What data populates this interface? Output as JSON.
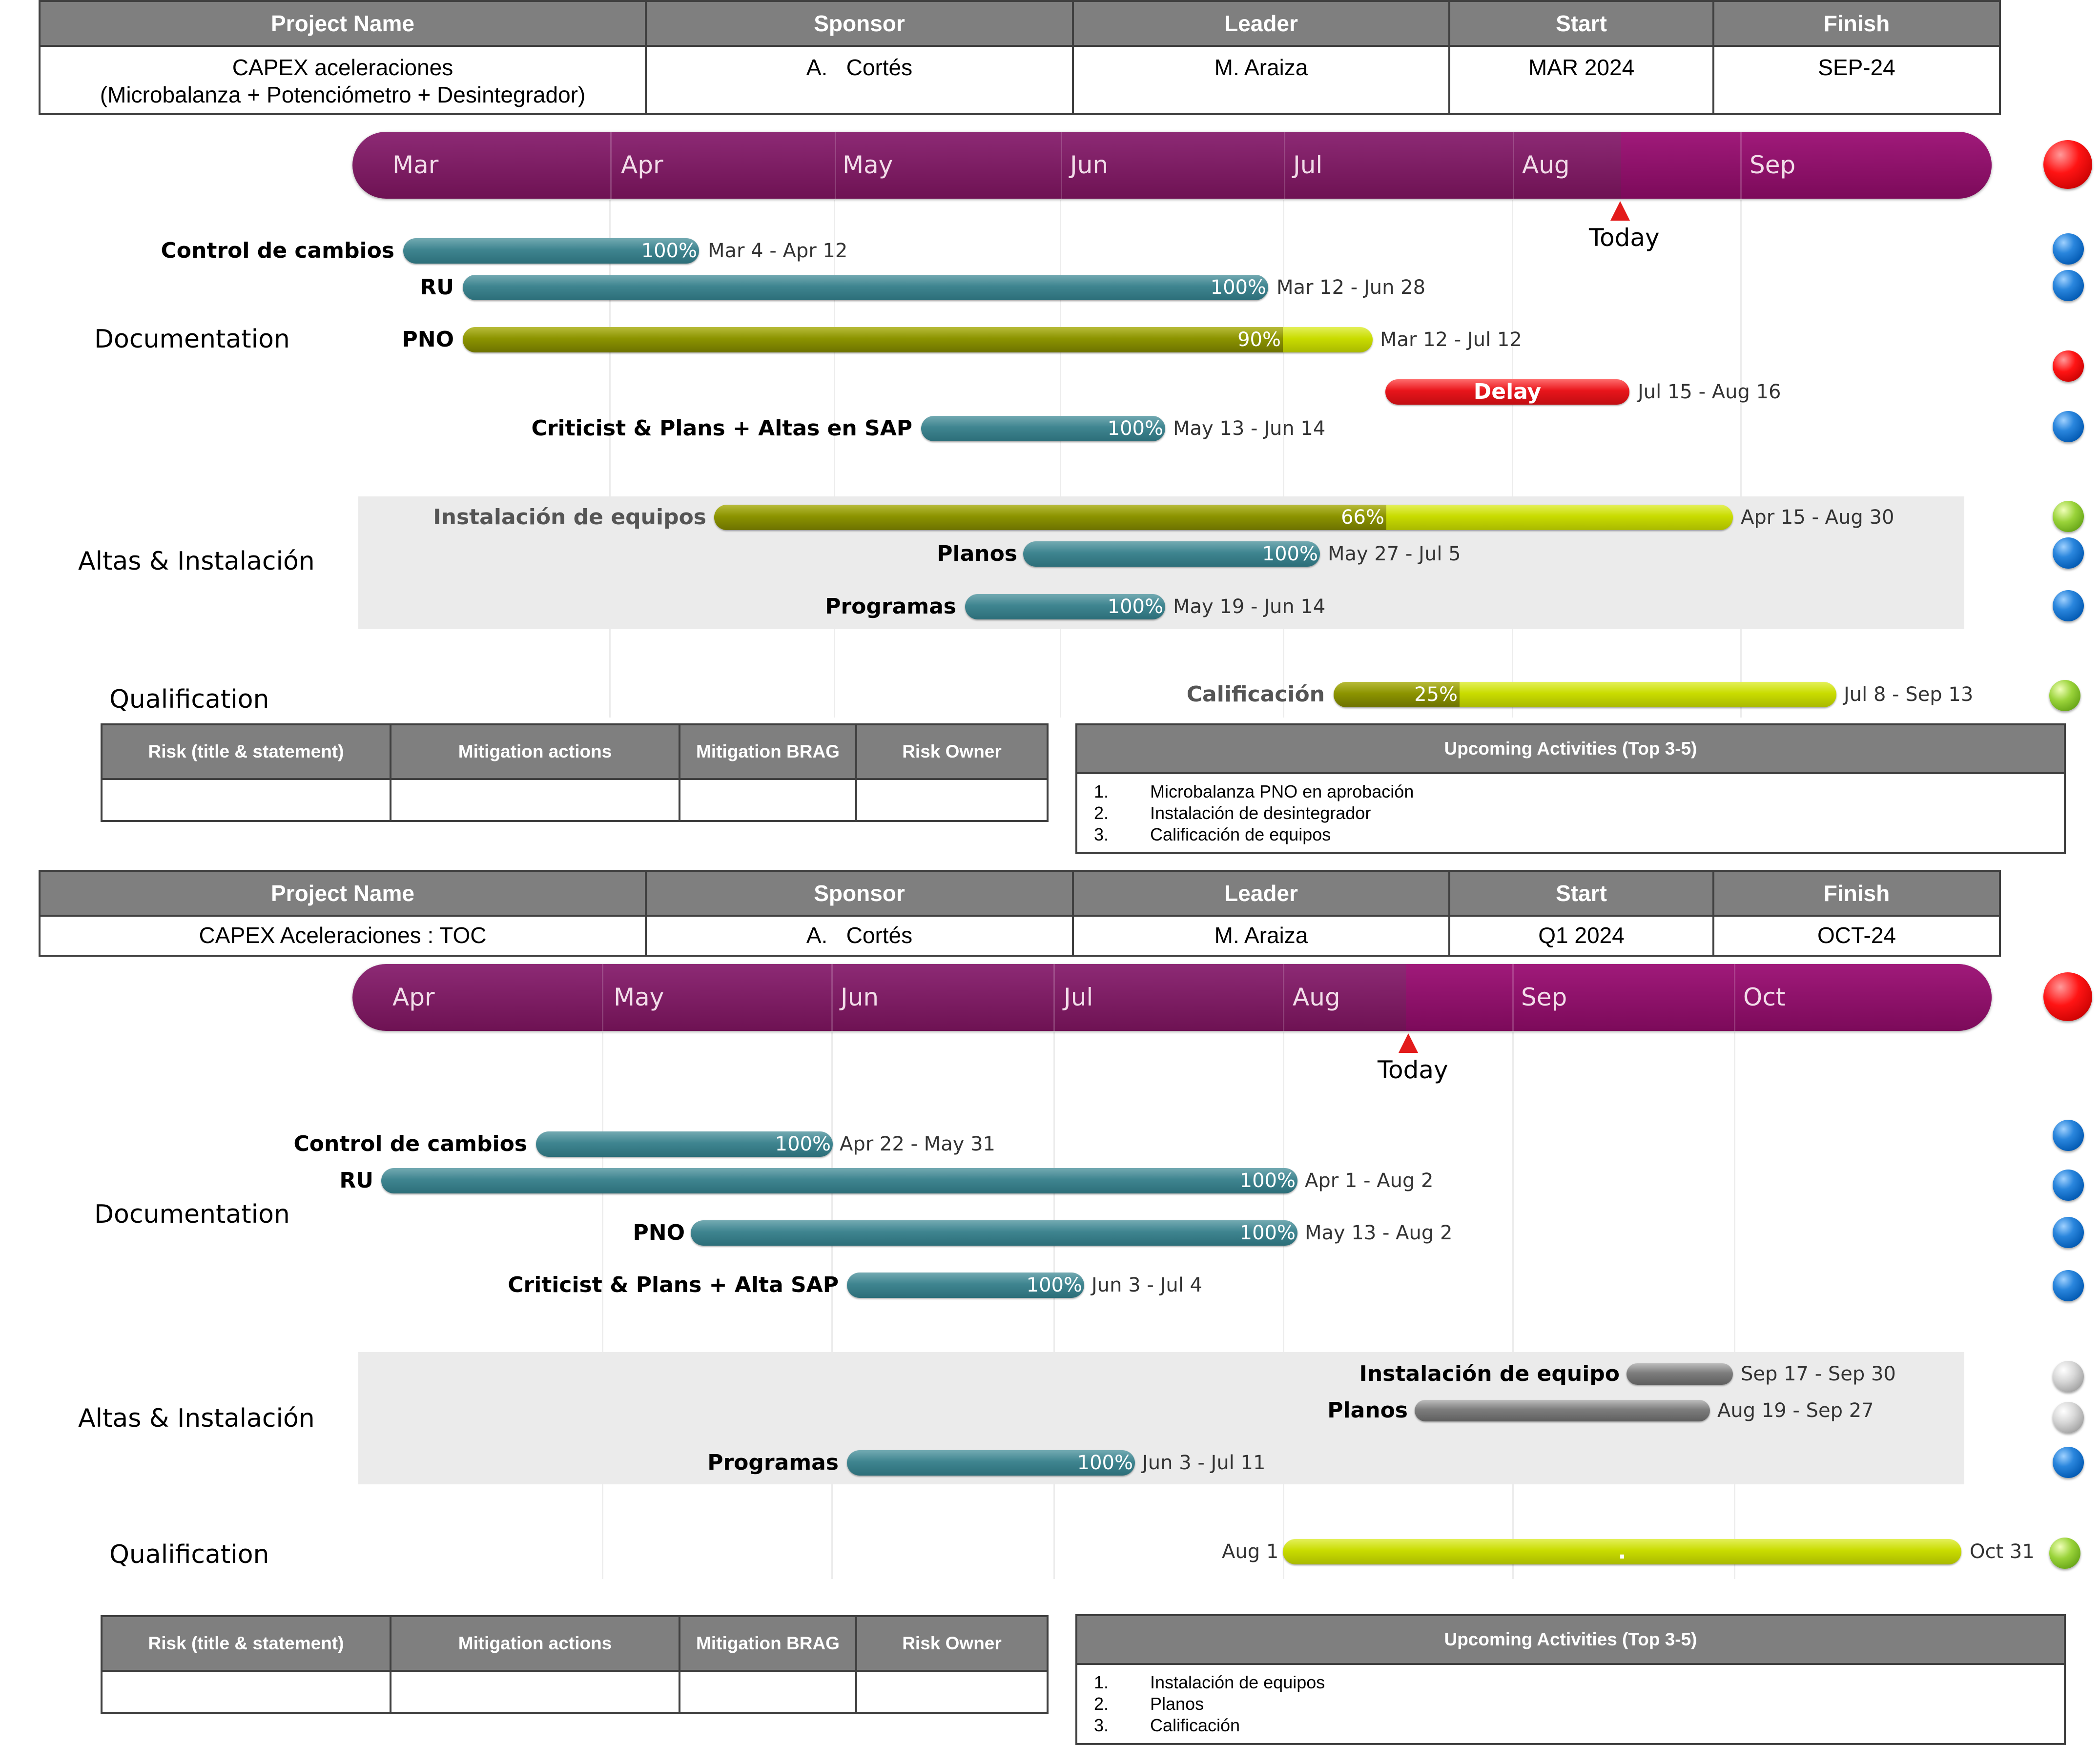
{
  "projects": [
    {
      "header": {
        "columns": [
          "Project Name",
          "Sponsor",
          "Leader",
          "Start",
          "Finish"
        ],
        "project_name_line1": "CAPEX aceleraciones",
        "project_name_line2": "(Microbalanza + Potenciómetro + Desintegrador)",
        "sponsor": "A.   Cortés",
        "leader": "M. Araiza",
        "start": "MAR 2024",
        "finish": "SEP-24"
      },
      "timeline": {
        "months": [
          "Mar",
          "Apr",
          "May",
          "Jun",
          "Jul",
          "Aug",
          "Sep"
        ],
        "today_label": "Today",
        "status_color": "red"
      },
      "groups": {
        "documentation": "Documentation",
        "altas": "Altas & Instalación",
        "qualification": "Qualification"
      },
      "tasks": [
        {
          "name": "Control de cambios",
          "percent": "100%",
          "dates": "Mar 4 - Apr 12",
          "status": "blue"
        },
        {
          "name": "RU",
          "percent": "100%",
          "dates": "Mar 12 - Jun 28",
          "status": "blue"
        },
        {
          "name": "PNO",
          "percent": "90%",
          "progress": 0.9,
          "dates": "Mar 12 - Jul 12",
          "status": ""
        },
        {
          "name": "",
          "bar_text": "Delay",
          "dates": "Jul 15 - Aug 16",
          "status": "red"
        },
        {
          "name": "Criticist & Plans + Altas en SAP",
          "percent": "100%",
          "dates": "May 13 - Jun 14",
          "status": "blue"
        },
        {
          "name": "Instalación de equipos",
          "percent": "66%",
          "progress": 0.66,
          "dates": "Apr 15 - Aug 30",
          "status": "green"
        },
        {
          "name": "Planos",
          "percent": "100%",
          "dates": "May 27 - Jul 5",
          "status": "blue"
        },
        {
          "name": "Programas",
          "percent": "100%",
          "dates": "May 19 - Jun 14",
          "status": "blue"
        },
        {
          "name": "Calificación",
          "percent": "25%",
          "progress": 0.25,
          "dates": "Jul 8 - Sep 13",
          "status": "green"
        }
      ],
      "risk_table": {
        "columns": [
          "Risk (title & statement)",
          "Mitigation actions",
          "Mitigation BRAG",
          "Risk Owner"
        ]
      },
      "upcoming": {
        "title": "Upcoming Activities (Top 3-5)",
        "items": [
          {
            "num": "1.",
            "text": "Microbalanza PNO en aprobación"
          },
          {
            "num": "2.",
            "text": "Instalación de desintegrador"
          },
          {
            "num": "3.",
            "text": "Calificación de equipos"
          }
        ]
      }
    },
    {
      "header": {
        "columns": [
          "Project Name",
          "Sponsor",
          "Leader",
          "Start",
          "Finish"
        ],
        "project_name_line1": "CAPEX Aceleraciones : TOC",
        "sponsor": "A.   Cortés",
        "leader": "M. Araiza",
        "start": "Q1 2024",
        "finish": "OCT-24"
      },
      "timeline": {
        "months": [
          "Apr",
          "May",
          "Jun",
          "Jul",
          "Aug",
          "Sep",
          "Oct"
        ],
        "today_label": "Today",
        "status_color": "red"
      },
      "groups": {
        "documentation": "Documentation",
        "altas": "Altas & Instalación",
        "qualification": "Qualification"
      },
      "tasks": [
        {
          "name": "Control de cambios",
          "percent": "100%",
          "dates": "Apr 22 - May 31",
          "status": "blue"
        },
        {
          "name": "RU",
          "percent": "100%",
          "dates": "Apr 1 - Aug 2",
          "status": "blue"
        },
        {
          "name": "PNO",
          "percent": "100%",
          "dates": "May 13 - Aug 2",
          "status": "blue"
        },
        {
          "name": "Criticist & Plans + Alta SAP",
          "percent": "100%",
          "dates": "Jun 3 - Jul 4",
          "status": "blue"
        },
        {
          "name": "Instalación de equipo",
          "dates": "Sep 17 - Sep 30",
          "status": "silver"
        },
        {
          "name": "Planos",
          "dates": "Aug 19 - Sep 27",
          "status": "silver"
        },
        {
          "name": "Programas",
          "percent": "100%",
          "dates": "Jun 3 - Jul 11",
          "status": "blue"
        },
        {
          "name": "",
          "bar_text": ".",
          "start_label": "Aug 1",
          "dates": "Oct 31",
          "status": "green"
        }
      ],
      "risk_table": {
        "columns": [
          "Risk (title & statement)",
          "Mitigation actions",
          "Mitigation BRAG",
          "Risk Owner"
        ]
      },
      "upcoming": {
        "title": "Upcoming Activities (Top 3-5)",
        "items": [
          {
            "num": "1.",
            "text": "Instalación de equipos"
          },
          {
            "num": "2.",
            "text": "Planos"
          },
          {
            "num": "3.",
            "text": "Calificación"
          }
        ]
      }
    }
  ]
}
